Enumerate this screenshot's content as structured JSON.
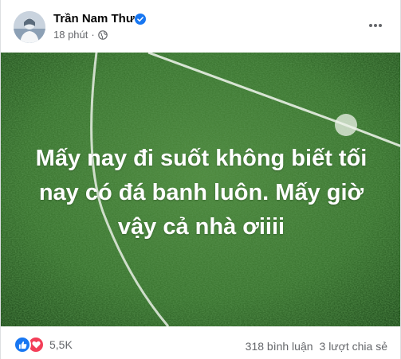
{
  "post": {
    "author": "Trần Nam Thư",
    "time": "18 phút",
    "separator": "·",
    "privacy_icon": "globe-icon",
    "verified_icon": "verified-badge-icon",
    "more_icon": "more-options-icon"
  },
  "media": {
    "text": "Mấy nay đi suốt không biết tối nay có đá banh luôn. Mấy giờ vậy cả nhà ơiiii"
  },
  "footer": {
    "reactions": [
      "like-icon",
      "love-icon"
    ],
    "reaction_count": "5,5K",
    "comments": "318 bình luận",
    "shares": "3 lượt chia sẻ"
  },
  "colors": {
    "accent": "#1877f2",
    "love": "#f33e58",
    "secondary_text": "#65676b",
    "grass": "#2f6b2a"
  }
}
